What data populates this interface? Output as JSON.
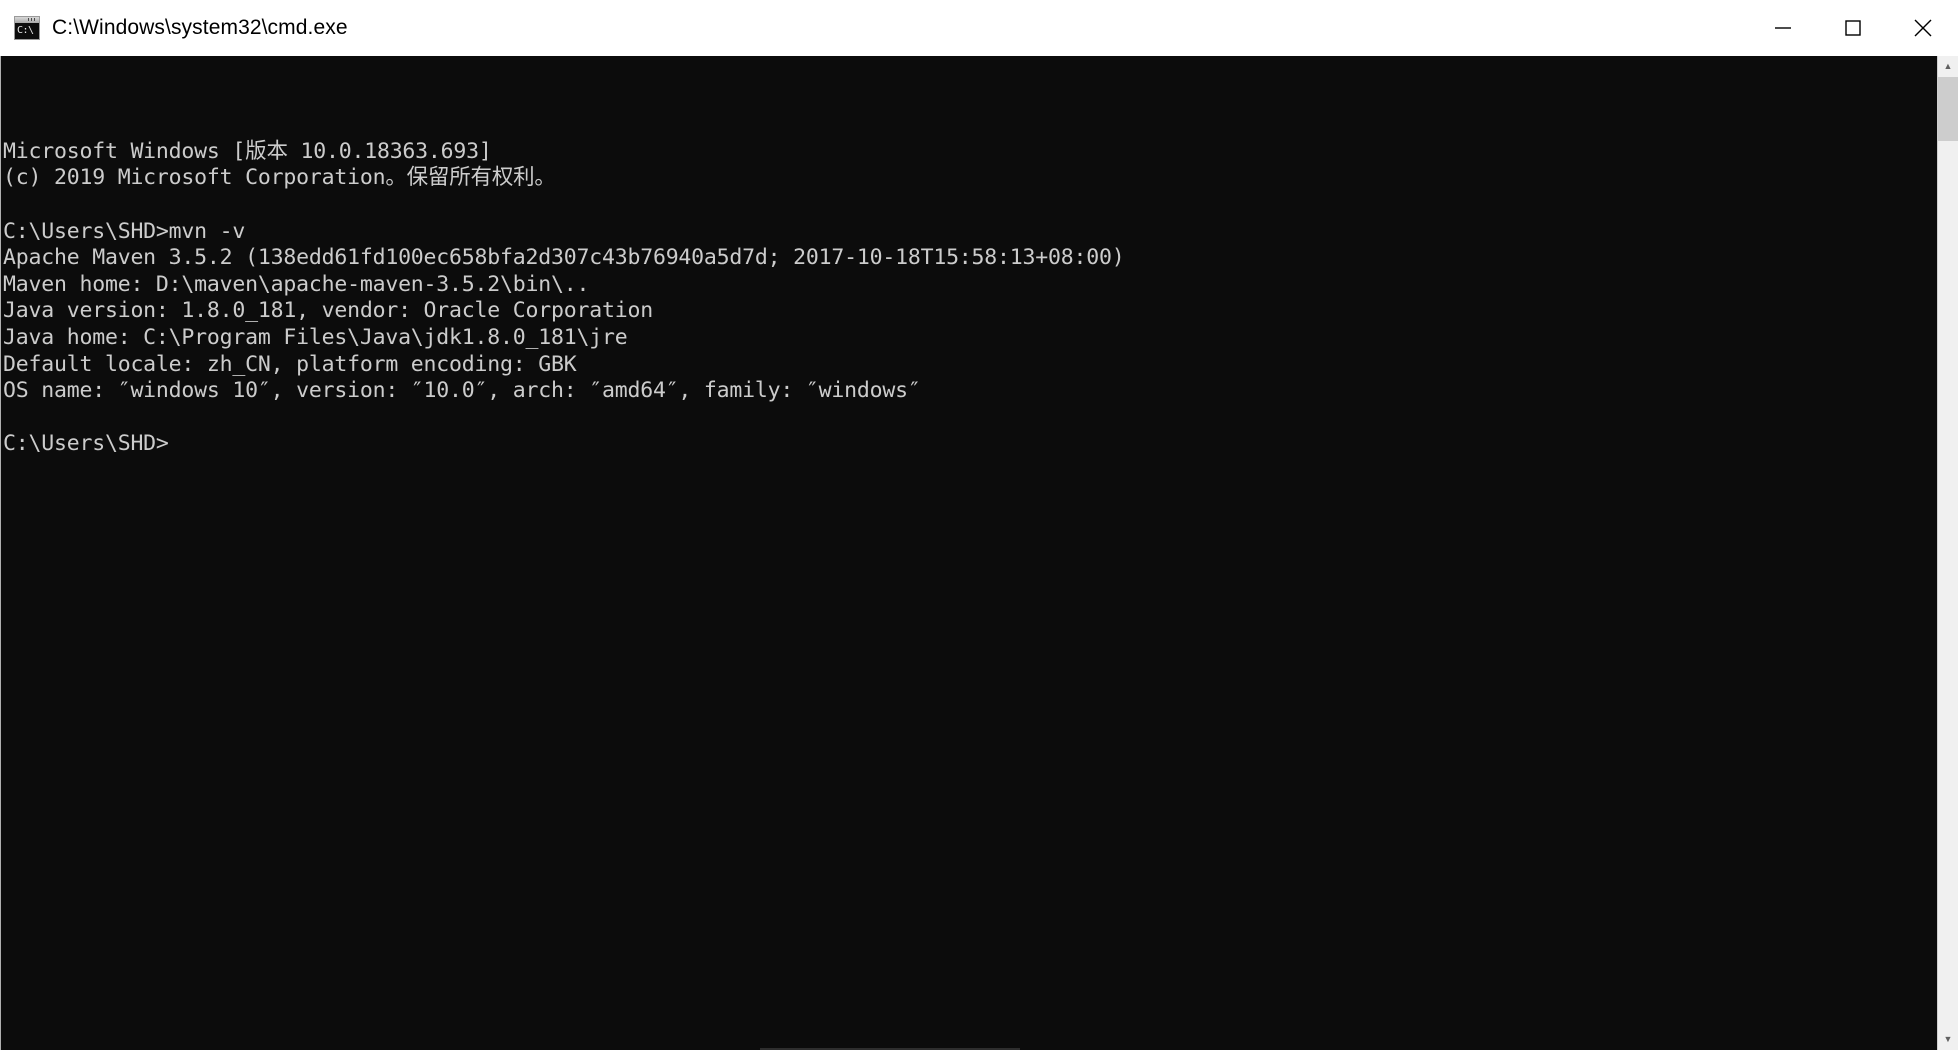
{
  "window": {
    "title": "C:\\Windows\\system32\\cmd.exe",
    "icon": "cmd-console-icon",
    "icon_prompt_text": "C:\\",
    "background_color": "#0c0c0c",
    "text_color": "#cccccc",
    "titlebar_color": "#ffffff"
  },
  "window_controls": {
    "minimize_label": "Minimize",
    "maximize_label": "Maximize",
    "close_label": "Close"
  },
  "console": {
    "lines": [
      "Microsoft Windows [版本 10.0.18363.693]",
      "(c) 2019 Microsoft Corporation。保留所有权利。",
      "",
      "C:\\Users\\SHD>mvn -v",
      "Apache Maven 3.5.2 (138edd61fd100ec658bfa2d307c43b76940a5d7d; 2017-10-18T15:58:13+08:00)",
      "Maven home: D:\\maven\\apache-maven-3.5.2\\bin\\..",
      "Java version: 1.8.0_181, vendor: Oracle Corporation",
      "Java home: C:\\Program Files\\Java\\jdk1.8.0_181\\jre",
      "Default locale: zh_CN, platform encoding: GBK",
      "OS name: ″windows 10″, version: ″10.0″, arch: ″amd64″, family: ″windows″",
      "",
      "C:\\Users\\SHD>"
    ],
    "command_entered": "mvn -v",
    "prompt": "C:\\Users\\SHD>",
    "maven_version": "3.5.2",
    "maven_commit": "138edd61fd100ec658bfa2d307c43b76940a5d7d",
    "maven_build_timestamp": "2017-10-18T15:58:13+08:00",
    "maven_home": "D:\\maven\\apache-maven-3.5.2\\bin\\..",
    "java_version": "1.8.0_181",
    "java_vendor": "Oracle Corporation",
    "java_home": "C:\\Program Files\\Java\\jdk1.8.0_181\\jre",
    "default_locale": "zh_CN",
    "platform_encoding": "GBK",
    "os_name": "windows 10",
    "os_version": "10.0",
    "os_arch": "amd64",
    "os_family": "windows",
    "windows_version": "10.0.18363.693"
  },
  "scrollbar": {
    "up_arrow": "▲",
    "down_arrow": "▼"
  }
}
